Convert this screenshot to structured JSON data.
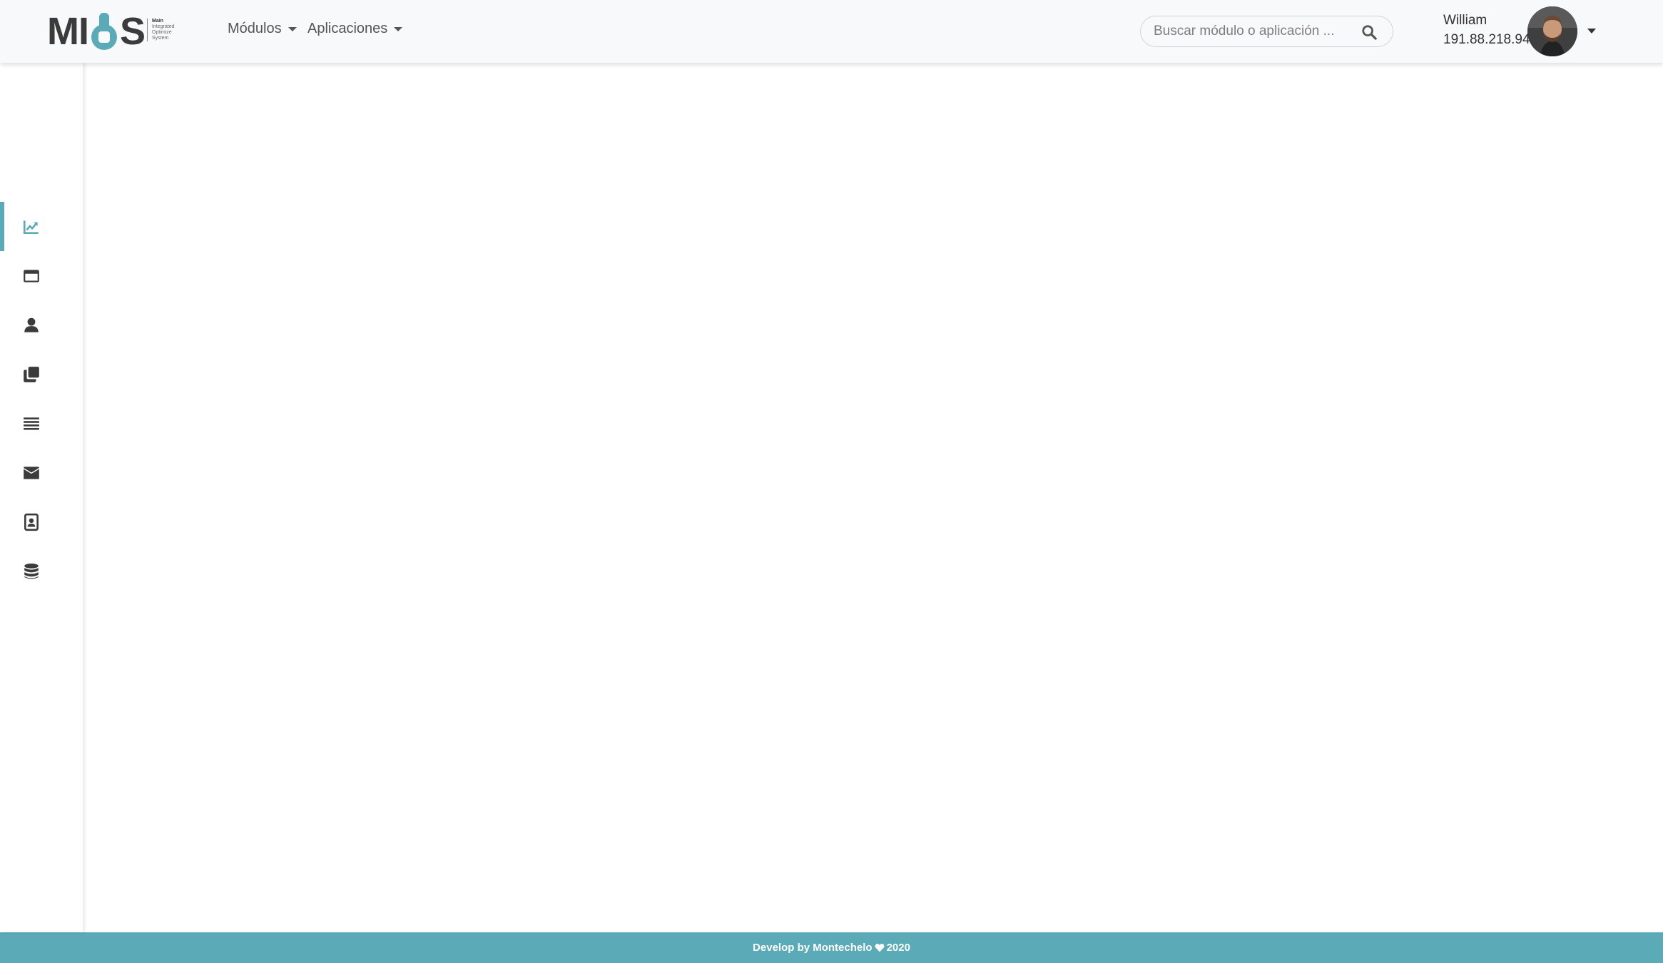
{
  "header": {
    "logo": {
      "word_left": "MI",
      "word_right": "S",
      "tagline": [
        "Main",
        "Integrated",
        "Optimize",
        "System"
      ]
    },
    "nav": [
      {
        "label": "Módulos"
      },
      {
        "label": "Aplicaciones"
      }
    ],
    "search": {
      "placeholder": "Buscar módulo o aplicación ...",
      "value": ""
    },
    "user": {
      "name": "William",
      "ip": "191.88.218.94"
    }
  },
  "sidebar": {
    "items": [
      {
        "icon": "chart-line-icon",
        "active": true
      },
      {
        "icon": "window-icon",
        "active": false
      },
      {
        "icon": "user-icon",
        "active": false
      },
      {
        "icon": "clone-icon",
        "active": false
      },
      {
        "icon": "list-icon",
        "active": false
      },
      {
        "icon": "envelope-icon",
        "active": false
      },
      {
        "icon": "address-book-icon",
        "active": false
      },
      {
        "icon": "database-icon",
        "active": false
      }
    ]
  },
  "footer": {
    "text_before": "Develop by Montechelo",
    "text_after": "2020"
  },
  "colors": {
    "accent": "#5aaab8",
    "header_bg": "#f8f9fa",
    "icon": "#3b3b3b"
  }
}
